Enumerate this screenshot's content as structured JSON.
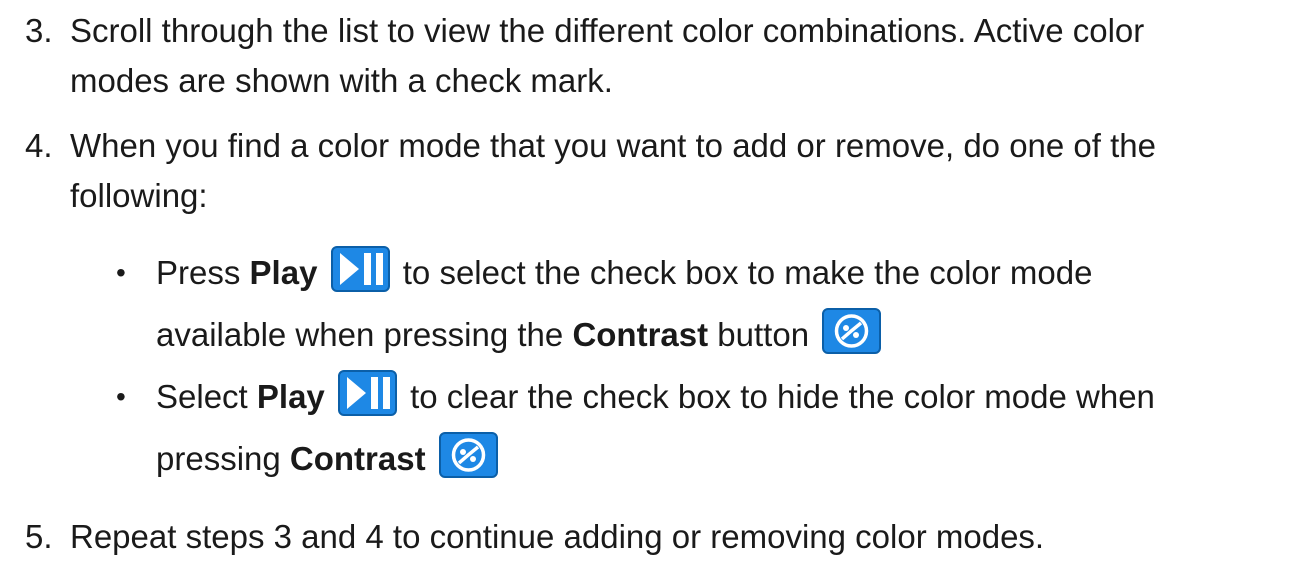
{
  "step3": {
    "number": "3.",
    "line1": "Scroll through the list to view the different color combinations. Active color",
    "line2": "modes are shown with a check mark."
  },
  "step4": {
    "number": "4.",
    "line1": "When you find a color mode that you want to add or remove, do one of the",
    "line2": "following:"
  },
  "bullet1": {
    "dot": "•",
    "pre": "Press ",
    "play": "Play",
    "mid": " to select the check box to make the color mode",
    "line2_pre": "available when pressing the ",
    "contrast": "Contrast",
    "line2_post": " button"
  },
  "bullet2": {
    "dot": "•",
    "pre": "Select ",
    "play": "Play",
    "mid": " to clear the check box to hide the color mode when",
    "line2_pre": "pressing ",
    "contrast": "Contrast"
  },
  "step5": {
    "number": "5.",
    "line1": "Repeat steps 3 and 4 to continue adding or removing color modes."
  },
  "icons": {
    "play_pause": "play-pause-icon",
    "contrast": "contrast-icon",
    "button_color": "#1e88e5",
    "button_border": "#0b5fa8"
  }
}
